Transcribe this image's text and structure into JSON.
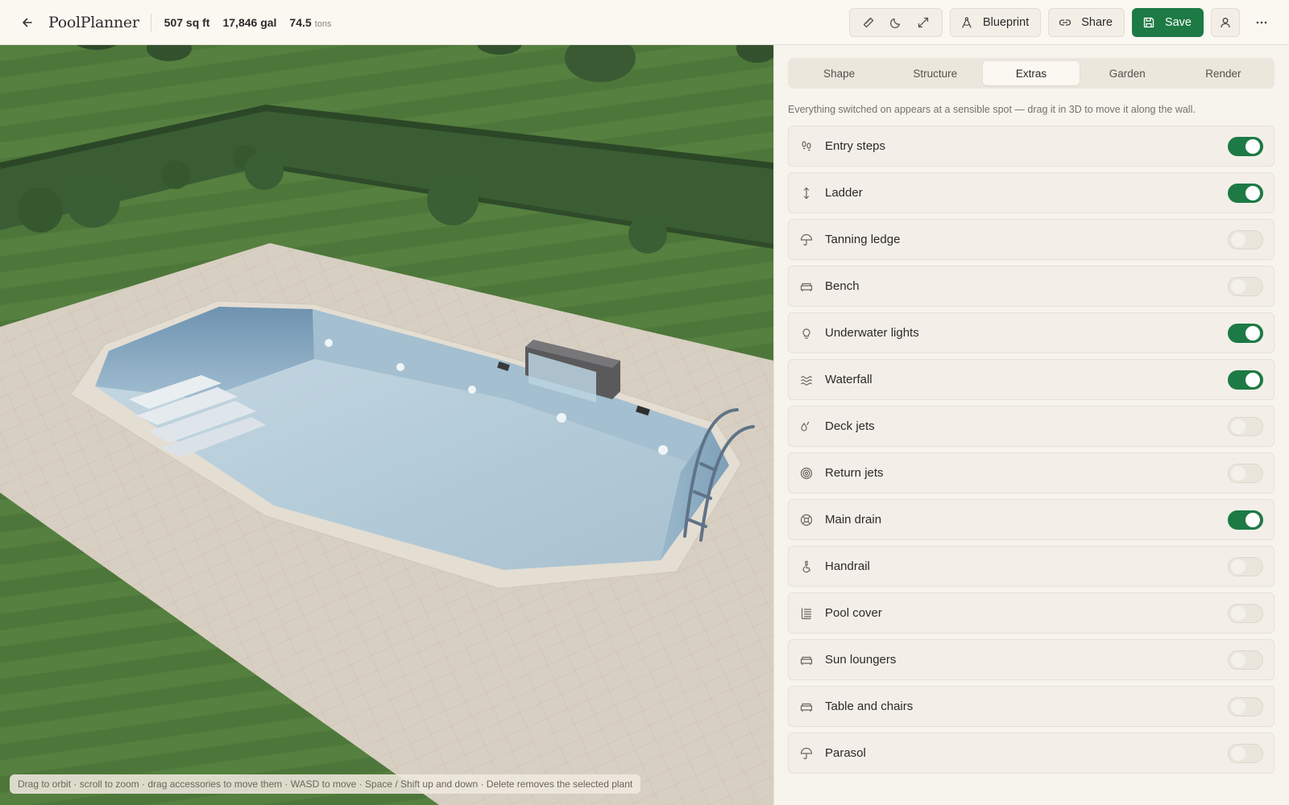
{
  "header": {
    "app_name": "PoolPlanner",
    "area": "507 sq ft",
    "volume": "17,846 gal",
    "weight_value": "74.5",
    "weight_unit": "tons",
    "blueprint_label": "Blueprint",
    "share_label": "Share",
    "save_label": "Save"
  },
  "tabs": [
    {
      "label": "Shape",
      "active": false
    },
    {
      "label": "Structure",
      "active": false
    },
    {
      "label": "Extras",
      "active": true
    },
    {
      "label": "Garden",
      "active": false
    },
    {
      "label": "Render",
      "active": false
    }
  ],
  "extras": {
    "description": "Everything switched on appears at a sensible spot — drag it in 3D to move it along the wall.",
    "items": [
      {
        "label": "Entry steps",
        "icon": "footsteps-icon",
        "on": true
      },
      {
        "label": "Ladder",
        "icon": "vertical-arrows-icon",
        "on": true
      },
      {
        "label": "Tanning ledge",
        "icon": "umbrella-icon",
        "on": false
      },
      {
        "label": "Bench",
        "icon": "sofa-icon",
        "on": false
      },
      {
        "label": "Underwater lights",
        "icon": "lightbulb-icon",
        "on": true
      },
      {
        "label": "Waterfall",
        "icon": "waves-icon",
        "on": true
      },
      {
        "label": "Deck jets",
        "icon": "droplets-icon",
        "on": false
      },
      {
        "label": "Return jets",
        "icon": "target-icon",
        "on": false
      },
      {
        "label": "Main drain",
        "icon": "drain-icon",
        "on": true
      },
      {
        "label": "Handrail",
        "icon": "accessibility-icon",
        "on": false
      },
      {
        "label": "Pool cover",
        "icon": "cover-icon",
        "on": false
      },
      {
        "label": "Sun loungers",
        "icon": "lounger-icon",
        "on": false
      },
      {
        "label": "Table and chairs",
        "icon": "armchair-icon",
        "on": false
      },
      {
        "label": "Parasol",
        "icon": "parasol-icon",
        "on": false
      }
    ]
  },
  "viewport": {
    "hint": "Drag to orbit · scroll to zoom · drag accessories to move them · WASD to move · Space / Shift up and down · Delete removes the selected plant"
  },
  "colors": {
    "accent": "#1d7a45",
    "lawn": "#4e7a3c",
    "deck": "#d6ccc0",
    "water": "#b9cfdb"
  }
}
